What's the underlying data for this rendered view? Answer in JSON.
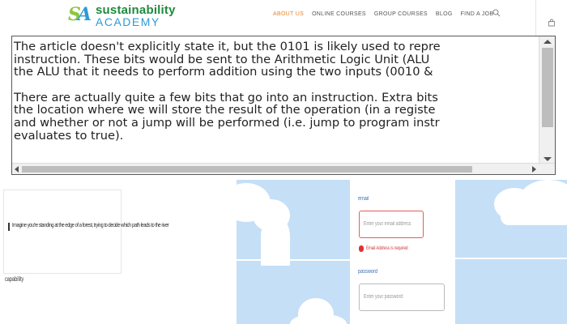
{
  "brand": {
    "mark": "SA",
    "name_top": "sustainability",
    "name_bottom": "ACADEMY"
  },
  "nav": {
    "items": [
      {
        "label": "ABOUT US",
        "active": true
      },
      {
        "label": "ONLINE COURSES"
      },
      {
        "label": "GROUP COURSES"
      },
      {
        "label": "BLOG"
      },
      {
        "label": "FIND A JOB"
      }
    ],
    "search_icon": "search-icon",
    "cart_icon": "shopping-bag-icon"
  },
  "article": {
    "paragraph1": [
      "The article doesn't explicitly state it, but the 0101 is likely used to repre",
      "instruction. These bits would be sent to the Arithmetic Logic Unit (ALU",
      "the ALU that it needs to perform addition using the two inputs (0010 &"
    ],
    "paragraph2": [
      "There are actually quite a few bits that go into an instruction. Extra bits",
      "the location where we will store the result of the operation (in a registe",
      "and whether or not a jump will be performed (i.e. jump to program instr",
      "evaluates to true)."
    ]
  },
  "left_fragment": {
    "line": "Imagine you're standing at the edge of a forest, trying to decide which path leads to the river",
    "word": "capability"
  },
  "form": {
    "email_label": "email",
    "email_placeholder": "Enter your email address",
    "email_error": "Email Address is required",
    "password_label": "password",
    "password_placeholder": "Enter your password"
  },
  "colors": {
    "accent": "#e8862a",
    "brand_green": "#1f8a3d",
    "brand_blue": "#2e9ad6",
    "sky": "#c5dff7",
    "error": "#e05d5d"
  }
}
